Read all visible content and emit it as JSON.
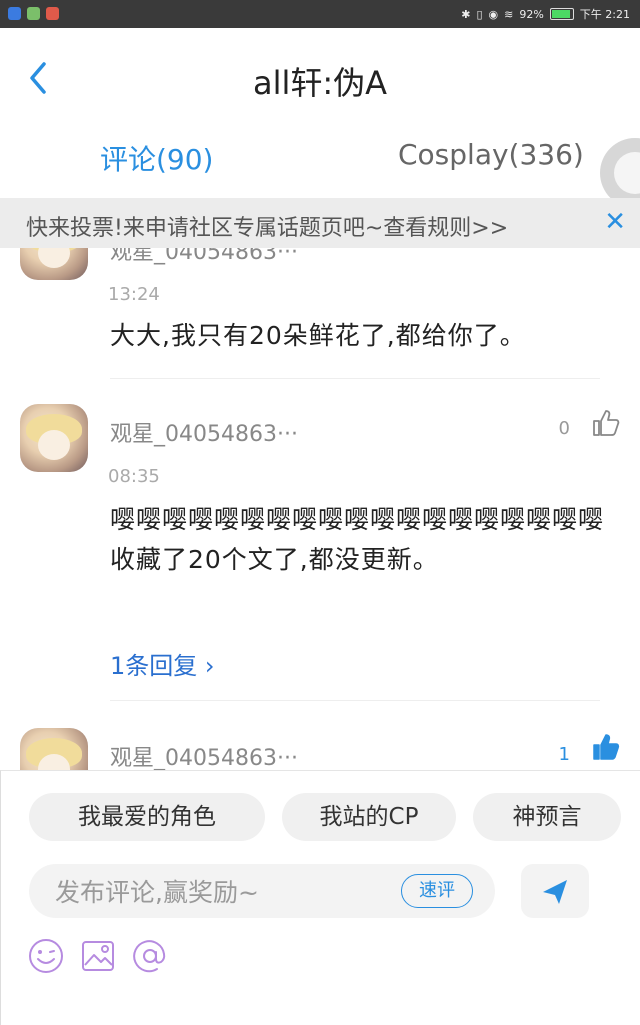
{
  "status": {
    "battery": "92%",
    "battery_level": 0.92,
    "time": "下午 2:21"
  },
  "header": {
    "title": "all轩:伪A"
  },
  "tabs": [
    {
      "label": "评论(90)",
      "active": true
    },
    {
      "label": "Cosplay(336)",
      "active": false
    }
  ],
  "notice": {
    "text": "快来投票!来申请社区专属话题页吧~查看规则>>"
  },
  "comments": [
    {
      "username": "观星_04054863···",
      "time": "13:24",
      "likes": "",
      "body": "大大,我只有20朵鲜花了,都给你了。"
    },
    {
      "username": "观星_04054863···",
      "time": "08:35",
      "likes": "0",
      "body": "嘤嘤嘤嘤嘤嘤嘤嘤嘤嘤嘤嘤嘤嘤嘤嘤嘤嘤嘤收藏了20个文了,都没更新。",
      "reply": "1条回复 ›"
    },
    {
      "username": "观星_04054863···",
      "time": "",
      "likes": "1",
      "body": ""
    }
  ],
  "quick_tags": [
    "我最爱的角色",
    "我站的CP",
    "神预言"
  ],
  "composer": {
    "placeholder": "发布评论,赢奖励~",
    "quick_label": "速评"
  },
  "colors": {
    "accent": "#2a8fe0",
    "link": "#2a6fcf",
    "tool_purple": "#b68be0"
  },
  "icons": [
    "back-icon",
    "close-icon",
    "like-icon",
    "send-icon",
    "emoji-icon",
    "image-icon",
    "at-icon"
  ]
}
